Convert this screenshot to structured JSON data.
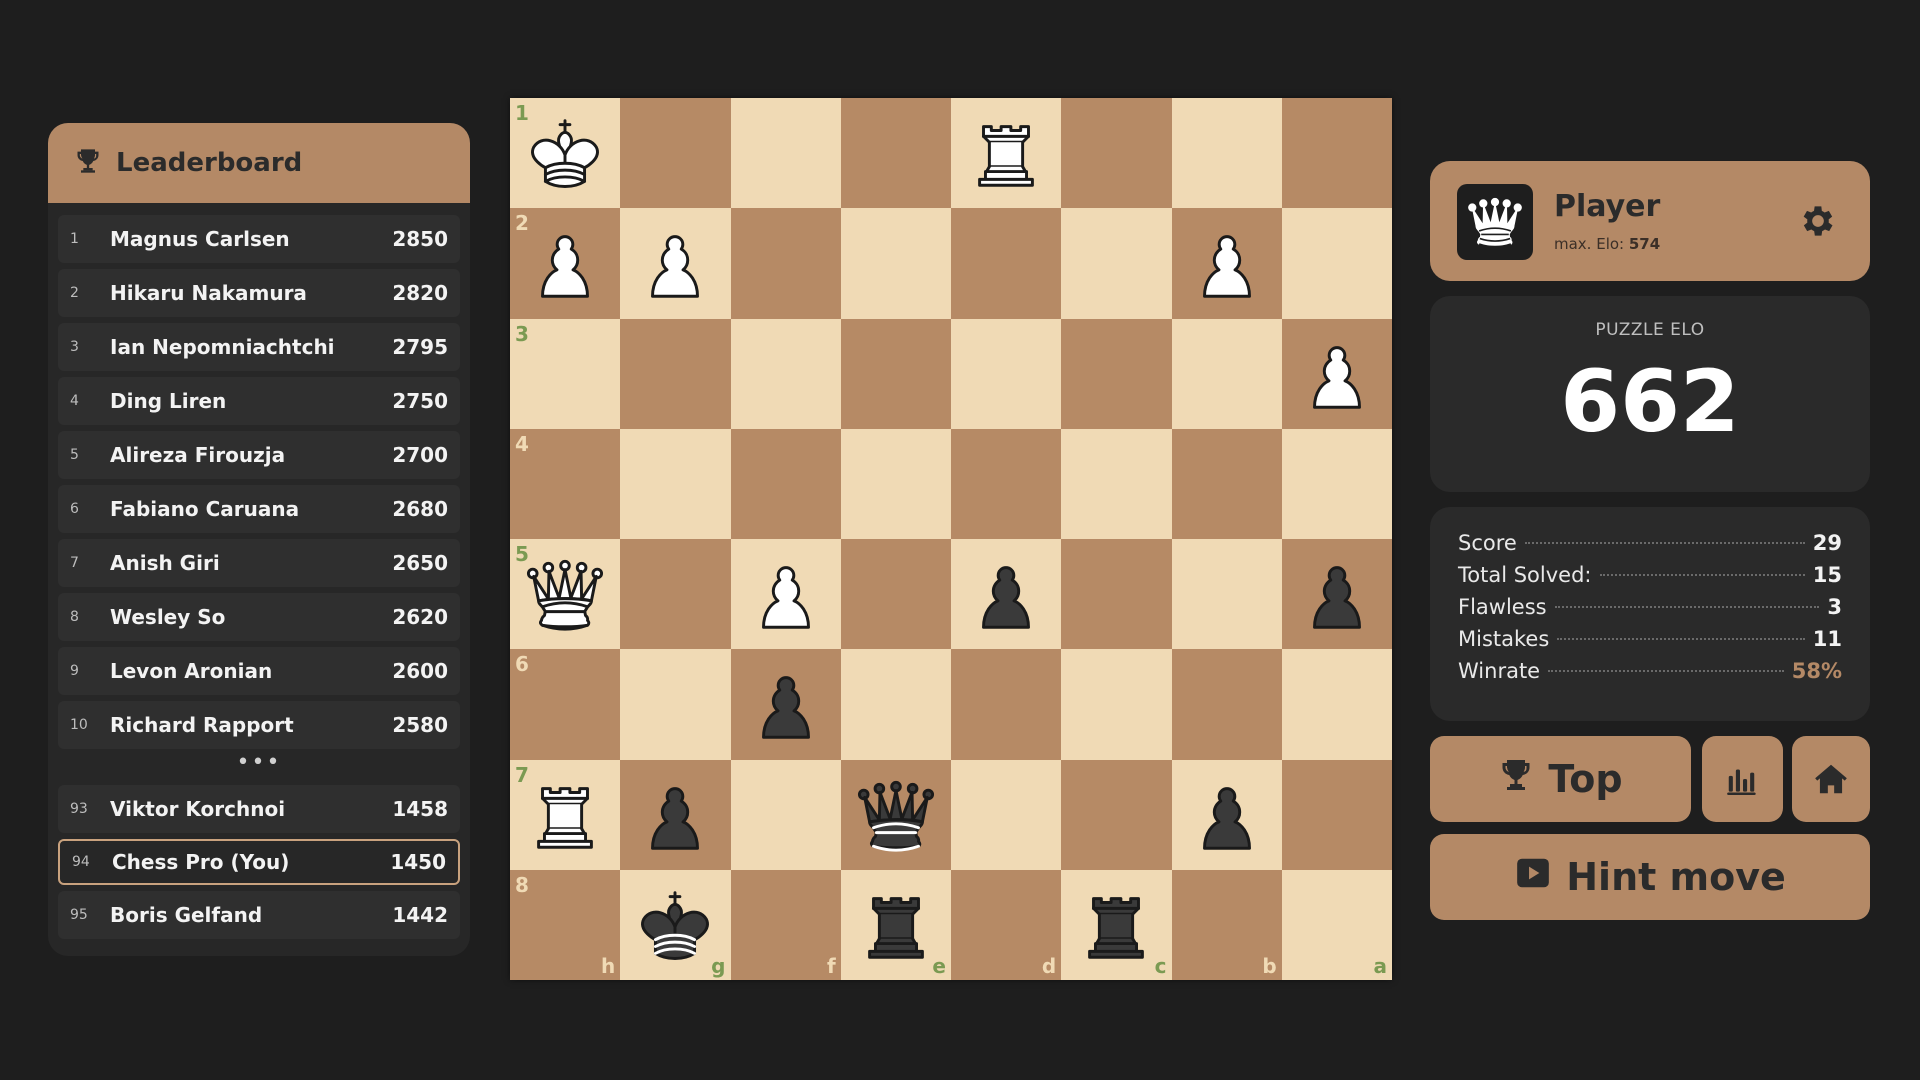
{
  "leaderboard": {
    "title": "Leaderboard",
    "icon": "trophy-icon",
    "top": [
      {
        "rank": "1",
        "name": "Magnus Carlsen",
        "score": "2850"
      },
      {
        "rank": "2",
        "name": "Hikaru Nakamura",
        "score": "2820"
      },
      {
        "rank": "3",
        "name": "Ian Nepomniachtchi",
        "score": "2795"
      },
      {
        "rank": "4",
        "name": "Ding Liren",
        "score": "2750"
      },
      {
        "rank": "5",
        "name": "Alireza Firouzja",
        "score": "2700"
      },
      {
        "rank": "6",
        "name": "Fabiano Caruana",
        "score": "2680"
      },
      {
        "rank": "7",
        "name": "Anish Giri",
        "score": "2650"
      },
      {
        "rank": "8",
        "name": "Wesley So",
        "score": "2620"
      },
      {
        "rank": "9",
        "name": "Levon Aronian",
        "score": "2600"
      },
      {
        "rank": "10",
        "name": "Richard Rapport",
        "score": "2580"
      }
    ],
    "ellipsis": "•••",
    "nearby": [
      {
        "rank": "93",
        "name": "Viktor Korchnoi",
        "score": "1458",
        "you": false
      },
      {
        "rank": "94",
        "name": "Chess Pro (You)",
        "score": "1450",
        "you": true
      },
      {
        "rank": "95",
        "name": "Boris Gelfand",
        "score": "1442",
        "you": false
      }
    ]
  },
  "board": {
    "rank_labels": [
      "1",
      "2",
      "3",
      "4",
      "5",
      "6",
      "7",
      "8"
    ],
    "file_labels": [
      "h",
      "g",
      "f",
      "e",
      "d",
      "c",
      "b",
      "a"
    ],
    "pieces": [
      {
        "row": 0,
        "col": 0,
        "color": "white",
        "type": "king"
      },
      {
        "row": 0,
        "col": 4,
        "color": "white",
        "type": "rook"
      },
      {
        "row": 1,
        "col": 0,
        "color": "white",
        "type": "pawn"
      },
      {
        "row": 1,
        "col": 1,
        "color": "white",
        "type": "pawn"
      },
      {
        "row": 1,
        "col": 6,
        "color": "white",
        "type": "pawn"
      },
      {
        "row": 2,
        "col": 7,
        "color": "white",
        "type": "pawn"
      },
      {
        "row": 4,
        "col": 0,
        "color": "white",
        "type": "queen"
      },
      {
        "row": 4,
        "col": 2,
        "color": "white",
        "type": "pawn"
      },
      {
        "row": 4,
        "col": 4,
        "color": "black",
        "type": "pawn"
      },
      {
        "row": 4,
        "col": 7,
        "color": "black",
        "type": "pawn"
      },
      {
        "row": 5,
        "col": 2,
        "color": "black",
        "type": "pawn"
      },
      {
        "row": 6,
        "col": 0,
        "color": "white",
        "type": "rook"
      },
      {
        "row": 6,
        "col": 1,
        "color": "black",
        "type": "pawn"
      },
      {
        "row": 6,
        "col": 3,
        "color": "black",
        "type": "queen"
      },
      {
        "row": 6,
        "col": 6,
        "color": "black",
        "type": "pawn"
      },
      {
        "row": 7,
        "col": 1,
        "color": "black",
        "type": "king"
      },
      {
        "row": 7,
        "col": 3,
        "color": "black",
        "type": "rook"
      },
      {
        "row": 7,
        "col": 5,
        "color": "black",
        "type": "rook"
      }
    ]
  },
  "player": {
    "name": "Player",
    "max_label": "max. Elo: ",
    "max_value": "574",
    "avatar_icon": "queen-icon",
    "settings_icon": "gear-icon"
  },
  "elo": {
    "label": "PUZZLE ELO",
    "value": "662"
  },
  "stats": [
    {
      "label": "Score",
      "value": "29",
      "accent": false
    },
    {
      "label": "Total Solved:",
      "value": "15",
      "accent": false
    },
    {
      "label": "Flawless",
      "value": "3",
      "accent": false
    },
    {
      "label": "Mistakes",
      "value": "11",
      "accent": false
    },
    {
      "label": "Winrate",
      "value": "58%",
      "accent": true
    }
  ],
  "buttons": {
    "top_label": "Top",
    "top_icon": "trophy-icon",
    "stats_icon": "bar-chart-icon",
    "home_icon": "home-icon",
    "hint_label": "Hint move",
    "hint_icon": "play-icon"
  },
  "colors": {
    "background": "#1e1e1e",
    "accent": "#b48966",
    "light_square": "#f0dab5",
    "dark_square": "#b68a65",
    "panel": "#2a2a2a"
  }
}
